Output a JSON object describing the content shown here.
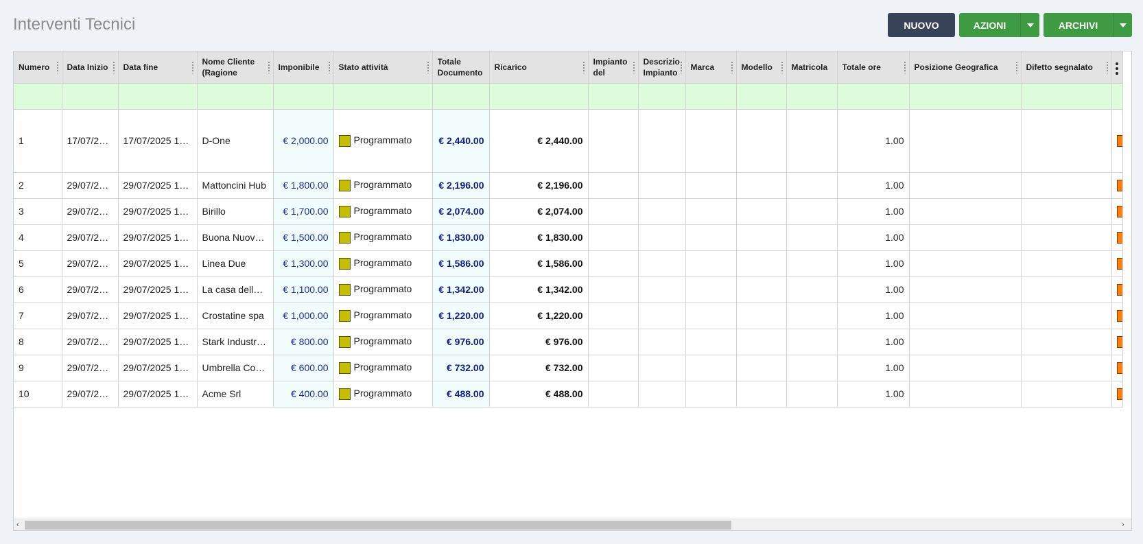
{
  "page": {
    "title": "Interventi Tecnici"
  },
  "toolbar": {
    "nuovo": "NUOVO",
    "azioni": "AZIONI",
    "archivi": "ARCHIVI"
  },
  "columns": [
    "Numero",
    "Data Inizio",
    "Data fine",
    "Nome Cliente (Ragione",
    "Imponibile",
    "Stato attività",
    "Totale Documento",
    "Ricarico",
    "Impianto del",
    "Descrizio Impianto",
    "Marca",
    "Modello",
    "Matricola",
    "Totale ore",
    "Posizione Geografica",
    "Difetto segnalato"
  ],
  "colors": {
    "status_programmato": "#c4be00",
    "row_marker": "#fa7f0b",
    "filter_row": "#dcfcdc"
  },
  "rows": [
    {
      "numero": "1",
      "data_inizio": "17/07/2…",
      "data_fine": "17/07/2025 1…",
      "cliente": "D-One",
      "imponibile": "€ 2,000.00",
      "stato": "Programmato",
      "totale": "€ 2,440.00",
      "ricarico": "€ 2,440.00",
      "ore": "1.00"
    },
    {
      "numero": "2",
      "data_inizio": "29/07/2…",
      "data_fine": "29/07/2025 1…",
      "cliente": "Mattoncini Hub",
      "imponibile": "€ 1,800.00",
      "stato": "Programmato",
      "totale": "€ 2,196.00",
      "ricarico": "€ 2,196.00",
      "ore": "1.00"
    },
    {
      "numero": "3",
      "data_inizio": "29/07/2…",
      "data_fine": "29/07/2025 1…",
      "cliente": "Birillo",
      "imponibile": "€ 1,700.00",
      "stato": "Programmato",
      "totale": "€ 2,074.00",
      "ricarico": "€ 2,074.00",
      "ore": "1.00"
    },
    {
      "numero": "4",
      "data_inizio": "29/07/2…",
      "data_fine": "29/07/2025 1…",
      "cliente": "Buona Nuova …",
      "imponibile": "€ 1,500.00",
      "stato": "Programmato",
      "totale": "€ 1,830.00",
      "ricarico": "€ 1,830.00",
      "ore": "1.00"
    },
    {
      "numero": "5",
      "data_inizio": "29/07/2…",
      "data_fine": "29/07/2025 1…",
      "cliente": "Linea Due",
      "imponibile": "€ 1,300.00",
      "stato": "Programmato",
      "totale": "€ 1,586.00",
      "ricarico": "€ 1,586.00",
      "ore": "1.00"
    },
    {
      "numero": "6",
      "data_inizio": "29/07/2…",
      "data_fine": "29/07/2025 1…",
      "cliente": "La casa della …",
      "imponibile": "€ 1,100.00",
      "stato": "Programmato",
      "totale": "€ 1,342.00",
      "ricarico": "€ 1,342.00",
      "ore": "1.00"
    },
    {
      "numero": "7",
      "data_inizio": "29/07/2…",
      "data_fine": "29/07/2025 1…",
      "cliente": "Crostatine spa",
      "imponibile": "€ 1,000.00",
      "stato": "Programmato",
      "totale": "€ 1,220.00",
      "ricarico": "€ 1,220.00",
      "ore": "1.00"
    },
    {
      "numero": "8",
      "data_inizio": "29/07/2…",
      "data_fine": "29/07/2025 1…",
      "cliente": "Stark Industri…",
      "imponibile": "€ 800.00",
      "stato": "Programmato",
      "totale": "€ 976.00",
      "ricarico": "€ 976.00",
      "ore": "1.00"
    },
    {
      "numero": "9",
      "data_inizio": "29/07/2…",
      "data_fine": "29/07/2025 1…",
      "cliente": "Umbrella Cor…",
      "imponibile": "€ 600.00",
      "stato": "Programmato",
      "totale": "€ 732.00",
      "ricarico": "€ 732.00",
      "ore": "1.00"
    },
    {
      "numero": "10",
      "data_inizio": "29/07/2…",
      "data_fine": "29/07/2025 1…",
      "cliente": "Acme Srl",
      "imponibile": "€ 400.00",
      "stato": "Programmato",
      "totale": "€ 488.00",
      "ricarico": "€ 488.00",
      "ore": "1.00"
    }
  ]
}
